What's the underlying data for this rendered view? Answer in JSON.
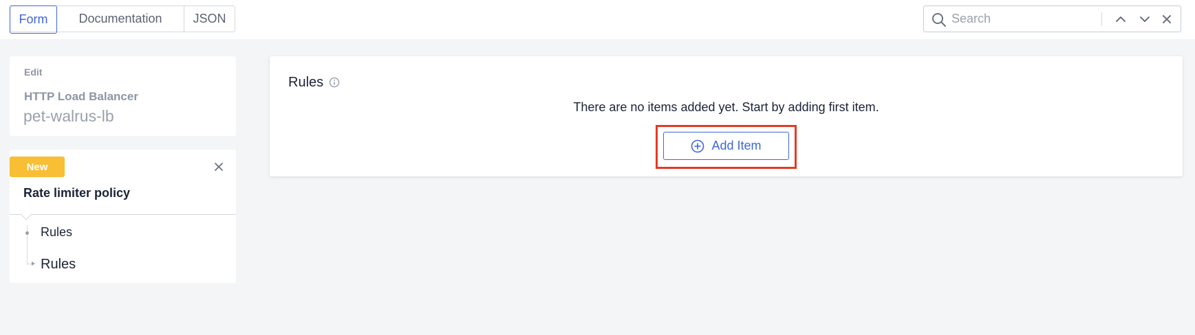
{
  "topbar": {
    "tabs": [
      {
        "label": "Form",
        "active": true
      },
      {
        "label": "Documentation",
        "active": false
      },
      {
        "label": "JSON",
        "active": false
      }
    ],
    "search": {
      "placeholder": "Search",
      "value": ""
    }
  },
  "sidebar": {
    "edit_card": {
      "label": "Edit",
      "type": "HTTP Load Balancer",
      "name": "pet-walrus-lb"
    },
    "policy_card": {
      "badge": "New",
      "title": "Rate limiter policy",
      "nav": [
        {
          "label": "Rules"
        },
        {
          "label": "Rules"
        }
      ]
    }
  },
  "main": {
    "section_title": "Rules",
    "empty_message": "There are no items added yet. Start by adding first item.",
    "add_button_label": "Add Item"
  },
  "colors": {
    "accent": "#3f66d6",
    "badge": "#f8be34",
    "highlight": "#e53a22",
    "background": "#f4f5f7"
  }
}
